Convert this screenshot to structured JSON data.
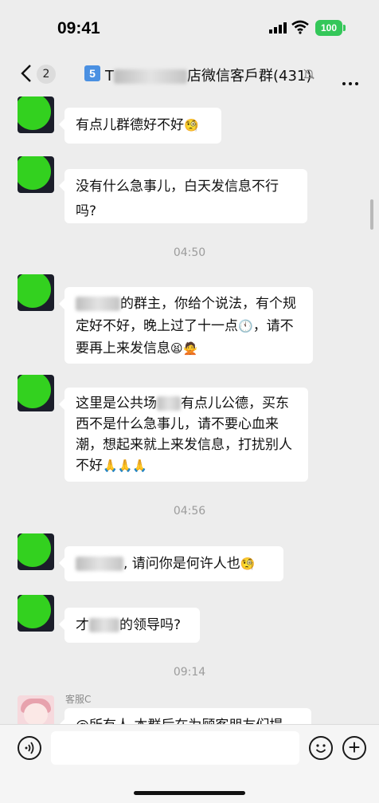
{
  "status": {
    "time": "09:41",
    "battery": "100"
  },
  "nav": {
    "back_count": "2",
    "group_num": "5",
    "title_prefix": "T",
    "title_suffix": "店微信客戶群(431)"
  },
  "messages": [
    {
      "type": "msg",
      "text": "有点儿群德好不好",
      "emoji": "🧐"
    },
    {
      "type": "msg",
      "text": "没有什么急事儿，白天发信息不行吗?"
    },
    {
      "type": "time",
      "text": "04:50"
    },
    {
      "type": "msg",
      "text_after_blur": "的群主，你给个说法，有个规定好不好，晚上过了十一点",
      "emoji_a": "🕚",
      "text_b": "，请不要再上来发信息",
      "emoji_b": "😫🙅"
    },
    {
      "type": "msg",
      "text_a": "这里是公共场",
      "text_b": "有点儿公德，买东西不是什么急事儿，请不要心血来潮，想起来就上来发信息，打扰别人不好",
      "emoji": "🙏🙏🙏"
    },
    {
      "type": "time",
      "text": "04:56"
    },
    {
      "type": "msg",
      "text_after_blur": ", 请问你是何许人也",
      "emoji": "🧐"
    },
    {
      "type": "msg",
      "text_a": "才",
      "text_b": "的领导吗?"
    },
    {
      "type": "time",
      "text": "09:14"
    },
    {
      "type": "msg",
      "sender": "客服C",
      "text": "@所有人 本群后在为顾客朋友们提"
    }
  ]
}
